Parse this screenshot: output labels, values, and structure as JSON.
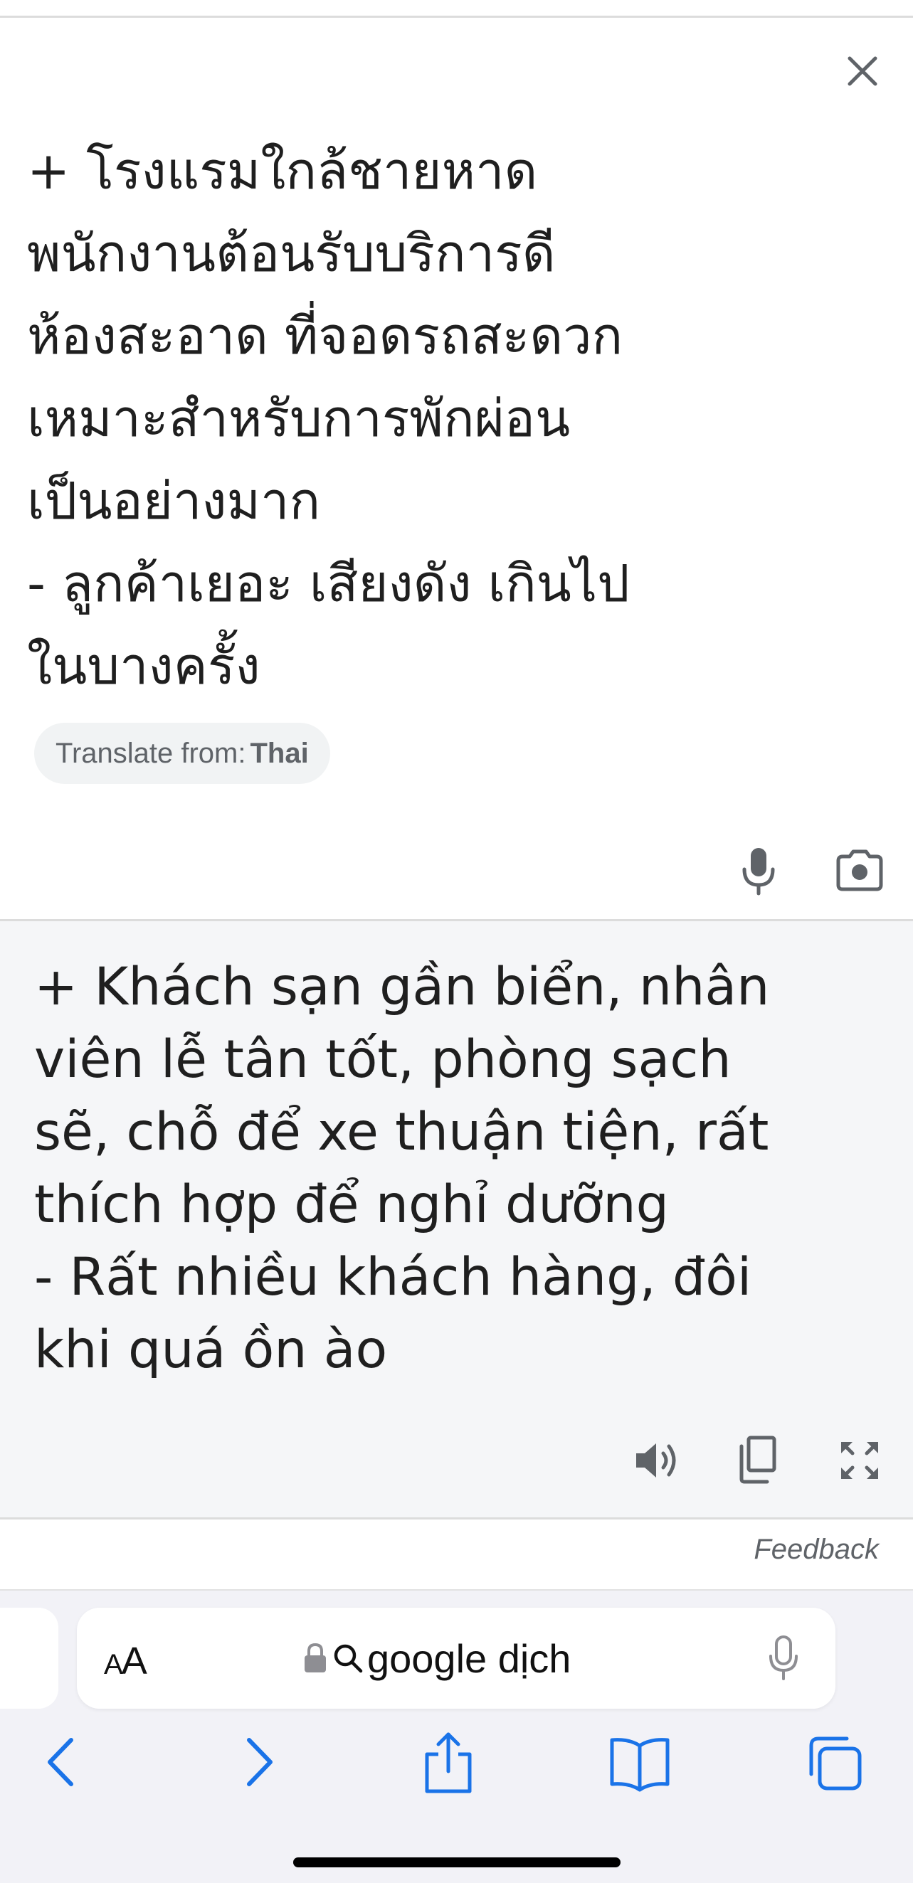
{
  "source": {
    "lines": [
      "+ โรงแรมใกล้ชายหาด",
      "พนักงานต้อนรับบริการดี",
      "ห้องสะอาด ที่จอดรถสะดวก",
      "เหมาะสำหรับการพักผ่อน",
      "เป็นอย่างมาก",
      "- ลูกค้าเยอะ เสียงดัง เกินไป",
      "ในบางครั้ง"
    ],
    "detect_label": "Translate from:",
    "detect_language": "Thai"
  },
  "result": {
    "lines": [
      "+ Khách sạn gần biển, nhân",
      "viên lễ tân tốt, phòng sạch",
      "sẽ, chỗ để xe thuận tiện, rất",
      "thích hợp để nghỉ dưỡng",
      "- Rất nhiều khách hàng, đôi",
      "khi quá ồn ào"
    ]
  },
  "feedback_label": "Feedback",
  "browser": {
    "aa_label_small": "A",
    "aa_label_large": "A",
    "url_text": "google dịch"
  },
  "colors": {
    "accent": "#1a73e8",
    "result_background": "#f5f6f8",
    "icon_gray": "#5f6368"
  },
  "icons": [
    "close-icon",
    "mic-icon",
    "camera-icon",
    "speaker-icon",
    "copy-icon",
    "fullscreen-icon",
    "lock-icon",
    "search-icon",
    "back-icon",
    "forward-icon",
    "share-icon",
    "bookmarks-icon",
    "tabs-icon"
  ]
}
